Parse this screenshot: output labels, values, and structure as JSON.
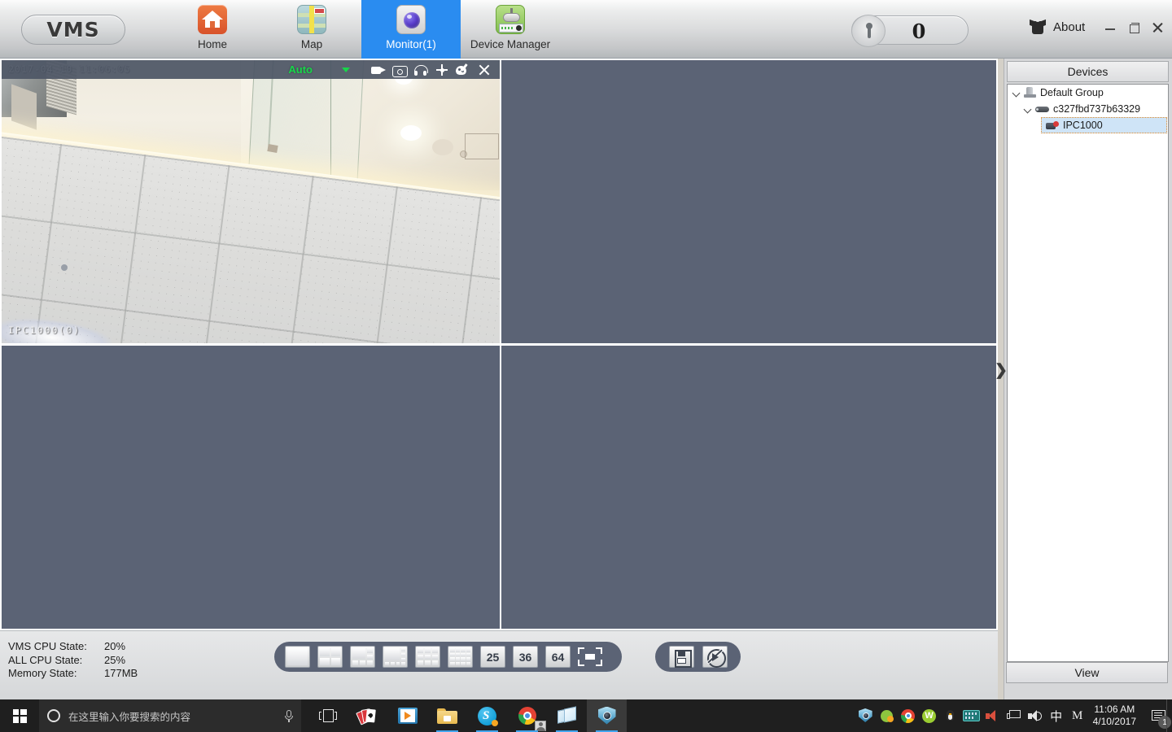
{
  "app": {
    "logo": "VMS",
    "counter_value": "0",
    "about_label": "About"
  },
  "nav": {
    "items": [
      {
        "label": "Home",
        "icon": "home-icon",
        "active": false
      },
      {
        "label": "Map",
        "icon": "map-icon",
        "active": false
      },
      {
        "label": "Monitor(1)",
        "icon": "monitor-camera-icon",
        "active": true
      },
      {
        "label": "Device Manager",
        "icon": "device-manager-icon",
        "active": false
      }
    ]
  },
  "window_controls": {
    "minimize": "minimize-icon",
    "maximize": "maximize-icon",
    "close": "close-icon"
  },
  "video_panel": {
    "stream_mode": "Auto",
    "timestamp": "2017-04-10 11:06:05",
    "camera_label": "IPC1000(0)",
    "toolbar_icons": [
      "record-icon",
      "snapshot-icon",
      "audio-icon",
      "ptz-icon",
      "image-settings-icon",
      "close-icon"
    ]
  },
  "status": {
    "rows": [
      {
        "key": "VMS CPU State:",
        "value": "20%"
      },
      {
        "key": "ALL CPU State:",
        "value": "25%"
      },
      {
        "key": "Memory State:",
        "value": "177MB"
      }
    ]
  },
  "layout_bar": {
    "grid_buttons": [
      {
        "name": "layout-1",
        "cells": 1
      },
      {
        "name": "layout-4",
        "cells": 4
      },
      {
        "name": "layout-6",
        "cells": 6
      },
      {
        "name": "layout-8",
        "cells": 8
      },
      {
        "name": "layout-9",
        "cells": 9
      },
      {
        "name": "layout-16",
        "cells": 16
      }
    ],
    "number_buttons": [
      "25",
      "36",
      "64"
    ],
    "fullscreen": "fullscreen-icon"
  },
  "tool_bar": {
    "buttons": [
      "save-view-icon",
      "auto-cycle-icon"
    ]
  },
  "devices": {
    "header": "Devices",
    "tree": [
      {
        "level": 1,
        "label": "Default Group",
        "icon": "group-icon",
        "expanded": true,
        "selected": false
      },
      {
        "level": 2,
        "label": "c327fbd737b63329",
        "icon": "nvr-icon",
        "expanded": true,
        "selected": false
      },
      {
        "level": 3,
        "label": "IPC1000",
        "icon": "camera-icon",
        "expanded": false,
        "selected": true
      }
    ],
    "view_button": "View",
    "collapse_handle": "❯"
  },
  "taskbar": {
    "start": "windows-start-icon",
    "search_placeholder": "在这里输入你要搜索的内容",
    "apps": [
      {
        "name": "task-view",
        "icon": "task-view-icon",
        "open": false,
        "active": false
      },
      {
        "name": "solitaire",
        "icon": "cards-icon",
        "open": false,
        "active": false
      },
      {
        "name": "movies-tv",
        "icon": "movies-tv-icon",
        "open": false,
        "active": false
      },
      {
        "name": "file-explorer",
        "icon": "folder-icon",
        "open": true,
        "active": false
      },
      {
        "name": "skype",
        "icon": "skype-icon",
        "open": true,
        "active": false
      },
      {
        "name": "chrome",
        "icon": "chrome-icon",
        "open": true,
        "active": false
      },
      {
        "name": "sticky-notes",
        "icon": "sticky-notes-icon",
        "open": true,
        "active": false
      },
      {
        "name": "vms",
        "icon": "vms-shield-icon",
        "open": true,
        "active": true
      }
    ],
    "tray": [
      "vms-shield-icon",
      "green-sync-icon",
      "chrome-icon",
      "w-browser-icon",
      "penguin-mail-icon",
      "ime-keyboard-icon",
      "muted-speaker-icon",
      "network-icon",
      "volume-icon"
    ],
    "ime_mode": "中",
    "ime_letter": "M",
    "clock_time": "11:06 AM",
    "clock_date": "4/10/2017",
    "notification_count": "1"
  },
  "colors": {
    "accent": "#2a8cf0",
    "pane_bg": "#5b6375",
    "auto_green": "#18d64a",
    "selection_blue": "#cfe4f7"
  }
}
